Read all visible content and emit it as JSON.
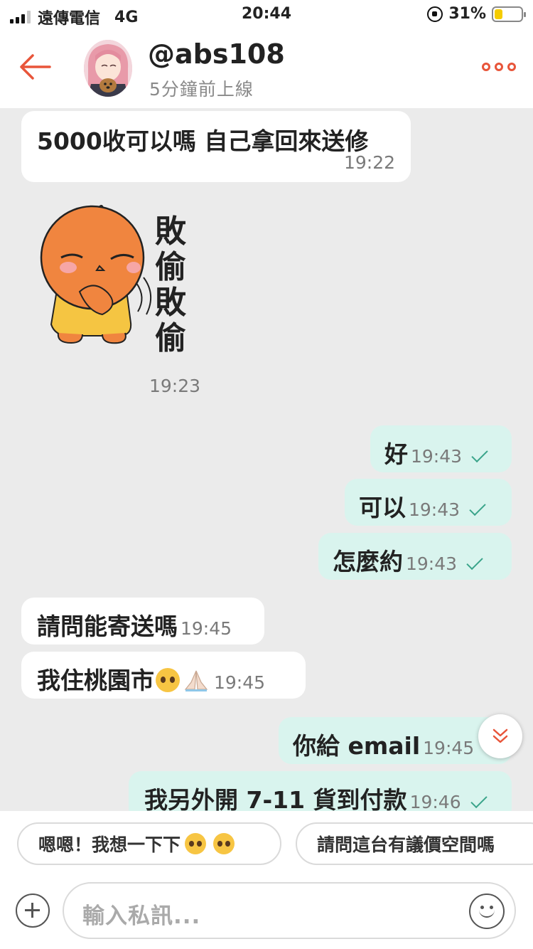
{
  "status_bar": {
    "carrier": "遠傳電信",
    "network": "4G",
    "time": "20:44",
    "battery": "31%",
    "battery_level": 0.31
  },
  "header": {
    "username": "@abs108",
    "online_status": "5分鐘前上線"
  },
  "messages": [
    {
      "dir": "in",
      "text": "5000收可以嗎 自己拿回來送修",
      "time": "19:22"
    },
    {
      "dir": "in",
      "type": "sticker",
      "sticker_text": [
        "敗",
        "偷",
        "敗",
        "偷"
      ],
      "time": "19:23"
    },
    {
      "dir": "out",
      "text": "好",
      "time": "19:43"
    },
    {
      "dir": "out",
      "text": "可以",
      "time": "19:43"
    },
    {
      "dir": "out",
      "text": "怎麼約",
      "time": "19:43"
    },
    {
      "dir": "in",
      "text": "請問能寄送嗎",
      "time": "19:45"
    },
    {
      "dir": "in",
      "text": "我住桃園市",
      "time": "19:45"
    },
    {
      "dir": "out",
      "text": "你給 email",
      "time": "19:45"
    },
    {
      "dir": "out",
      "text": "我另外開 7-11 貨到付款",
      "time": "19:46"
    }
  ],
  "quick_replies": [
    {
      "label": "嗯嗯！我想一下下"
    },
    {
      "label": "請問這台有議價空間嗎"
    }
  ],
  "input": {
    "placeholder": "輸入私訊..."
  },
  "colors": {
    "accent": "#e8553a",
    "outgoing_bubble": "#d9f4ee",
    "check": "#3aa48a",
    "chat_bg": "#ebebeb"
  }
}
